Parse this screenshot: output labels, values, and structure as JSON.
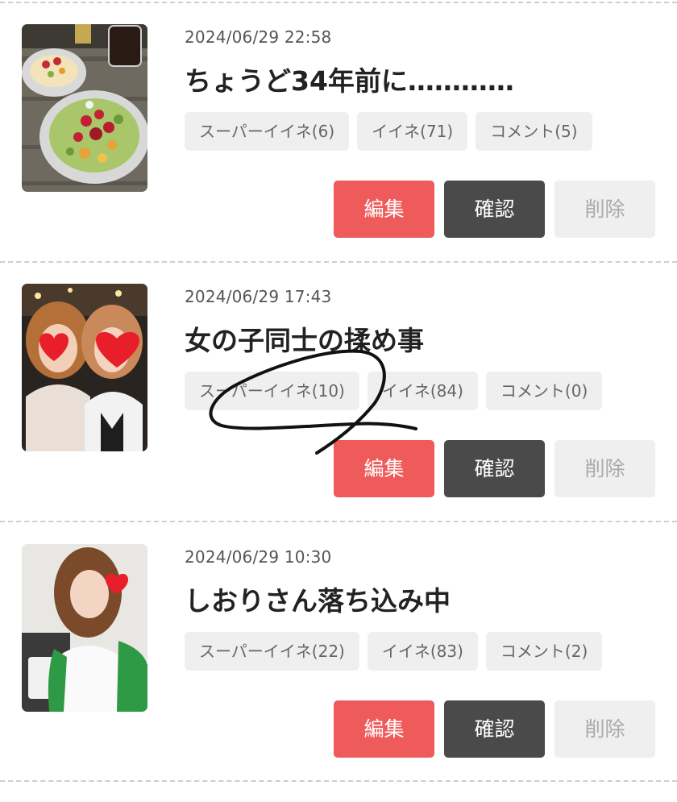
{
  "posts": [
    {
      "timestamp": "2024/06/29 22:58",
      "title": "ちょうど34年前に…………",
      "thumbnail_icon": "food-photo-icon",
      "super_like_label": "スーパーイイネ(6)",
      "like_label": "イイネ(71)",
      "comment_label": "コメント(5)",
      "edit_label": "編集",
      "confirm_label": "確認",
      "delete_label": "削除"
    },
    {
      "timestamp": "2024/06/29 17:43",
      "title": "女の子同士の揉め事",
      "thumbnail_icon": "two-women-photo-icon",
      "super_like_label": "スーパーイイネ(10)",
      "like_label": "イイネ(84)",
      "comment_label": "コメント(0)",
      "edit_label": "編集",
      "confirm_label": "確認",
      "delete_label": "削除"
    },
    {
      "timestamp": "2024/06/29 10:30",
      "title": "しおりさん落ち込み中",
      "thumbnail_icon": "woman-portrait-photo-icon",
      "super_like_label": "スーパーイイネ(22)",
      "like_label": "イイネ(83)",
      "comment_label": "コメント(2)",
      "edit_label": "編集",
      "confirm_label": "確認",
      "delete_label": "削除"
    }
  ],
  "colors": {
    "edit_button": "#ef5b5b",
    "confirm_button": "#4a4a4a",
    "delete_button": "#efefef",
    "chip_background": "#efefef",
    "divider": "#cfcfcf"
  }
}
